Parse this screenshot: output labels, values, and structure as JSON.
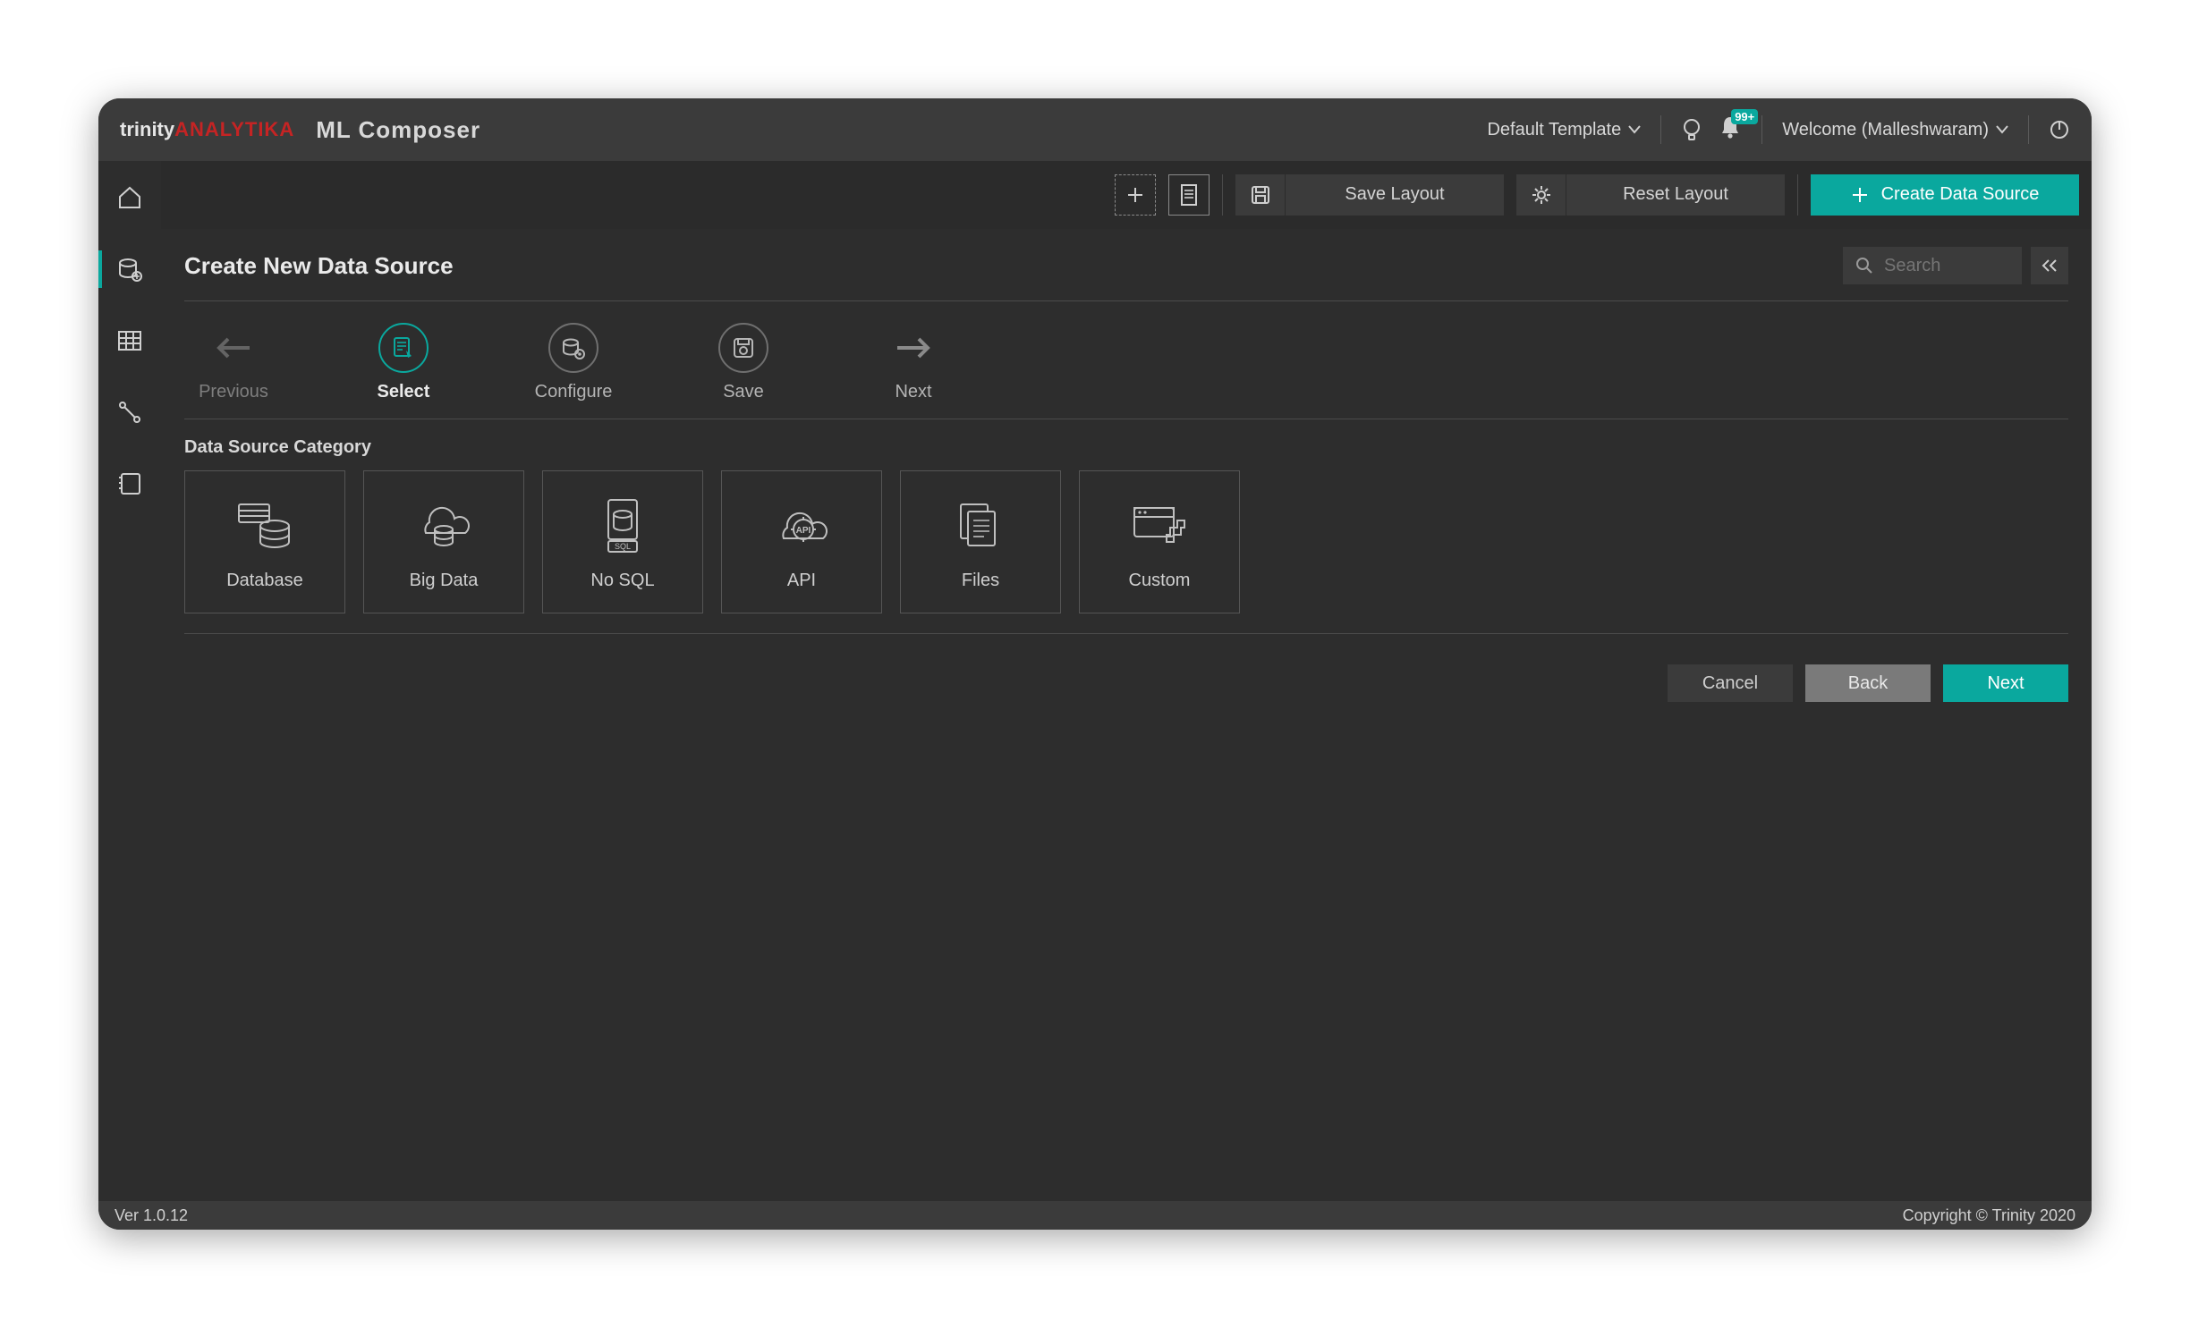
{
  "brand": {
    "trinity": "trinity",
    "analytika": "ANALYTIKA",
    "app": "ML Composer"
  },
  "topbar": {
    "template_label": "Default Template",
    "notification_badge": "99+",
    "welcome_label": "Welcome (Malleshwaram)"
  },
  "toolbar": {
    "save_layout": "Save Layout",
    "reset_layout": "Reset Layout",
    "create_ds": "Create Data Source"
  },
  "page": {
    "title": "Create New Data Source",
    "search_placeholder": "Search"
  },
  "steps": {
    "previous": "Previous",
    "select": "Select",
    "configure": "Configure",
    "save": "Save",
    "next": "Next"
  },
  "section": {
    "category_title": "Data Source Category"
  },
  "categories": [
    {
      "label": "Database"
    },
    {
      "label": "Big Data"
    },
    {
      "label": "No SQL"
    },
    {
      "label": "API"
    },
    {
      "label": "Files"
    },
    {
      "label": "Custom"
    }
  ],
  "wizard_buttons": {
    "cancel": "Cancel",
    "back": "Back",
    "next": "Next"
  },
  "footer": {
    "version": "Ver 1.0.12",
    "copyright": "Copyright © Trinity 2020"
  }
}
